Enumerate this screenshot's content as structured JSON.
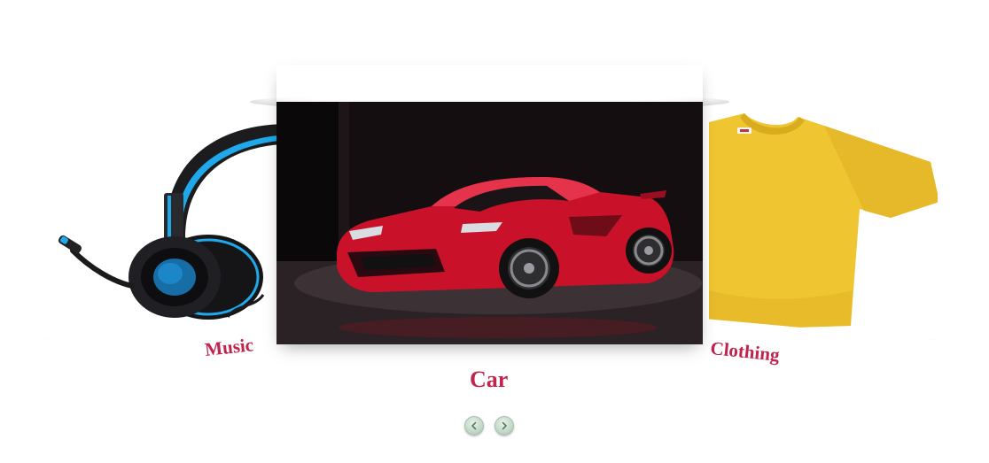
{
  "carousel": {
    "slides": [
      {
        "label": "Music",
        "image": "headphones"
      },
      {
        "label": "Car",
        "image": "red-sports-car"
      },
      {
        "label": "Clothing",
        "image": "yellow-t-shirt"
      }
    ],
    "active_index": 1,
    "nav": {
      "prev_icon": "chevron-left-icon",
      "next_icon": "chevron-right-icon"
    }
  },
  "colors": {
    "label": "#c0244d",
    "nav_button": "#c3d8c6",
    "car": "#d2142e",
    "headphone_accent": "#1fa9ea",
    "tshirt": "#efc531"
  }
}
